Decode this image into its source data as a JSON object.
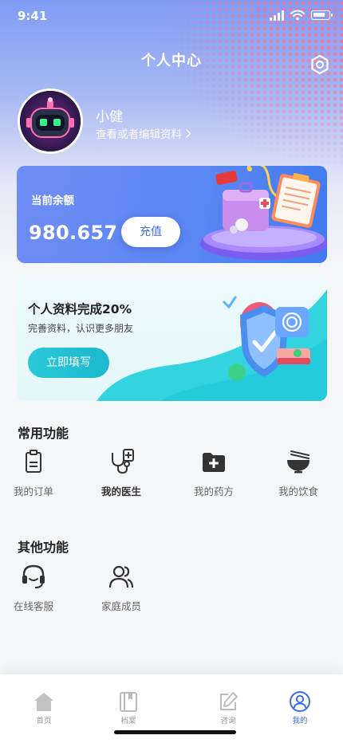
{
  "status_bar": {
    "time": "9:41"
  },
  "header": {
    "title": "个人中心"
  },
  "profile": {
    "name": "小健",
    "edit_link": "查看或者编辑资料"
  },
  "balance": {
    "label": "当前余额",
    "value": "980.657",
    "button": "充值"
  },
  "profile_complete": {
    "title": "个人资料完成20%",
    "progress_percent": 20,
    "subtitle": "完善资料，认识更多朋友",
    "button": "立即填写"
  },
  "common_functions": {
    "title": "常用功能",
    "items": [
      {
        "label": "我的订单",
        "icon": "clipboard-icon"
      },
      {
        "label": "我的医生",
        "icon": "stethoscope-icon"
      },
      {
        "label": "我的药方",
        "icon": "prescription-folder-icon"
      },
      {
        "label": "我的饮食",
        "icon": "noodle-bowl-icon"
      }
    ]
  },
  "other_functions": {
    "title": "其他功能",
    "items": [
      {
        "label": "在线客服",
        "icon": "headset-icon"
      },
      {
        "label": "家庭成员",
        "icon": "family-icon"
      }
    ]
  },
  "tabbar": {
    "items": [
      {
        "label": "首页",
        "icon": "home-icon"
      },
      {
        "label": "档案",
        "icon": "archive-book-icon"
      },
      {
        "label": "咨询",
        "icon": "edit-icon"
      },
      {
        "label": "我的",
        "icon": "user-icon",
        "active": true
      }
    ]
  },
  "colors": {
    "accent": "#3f6fe8",
    "teal": "#1cb8cf",
    "header_gradient_start": "#7f9cf5"
  }
}
